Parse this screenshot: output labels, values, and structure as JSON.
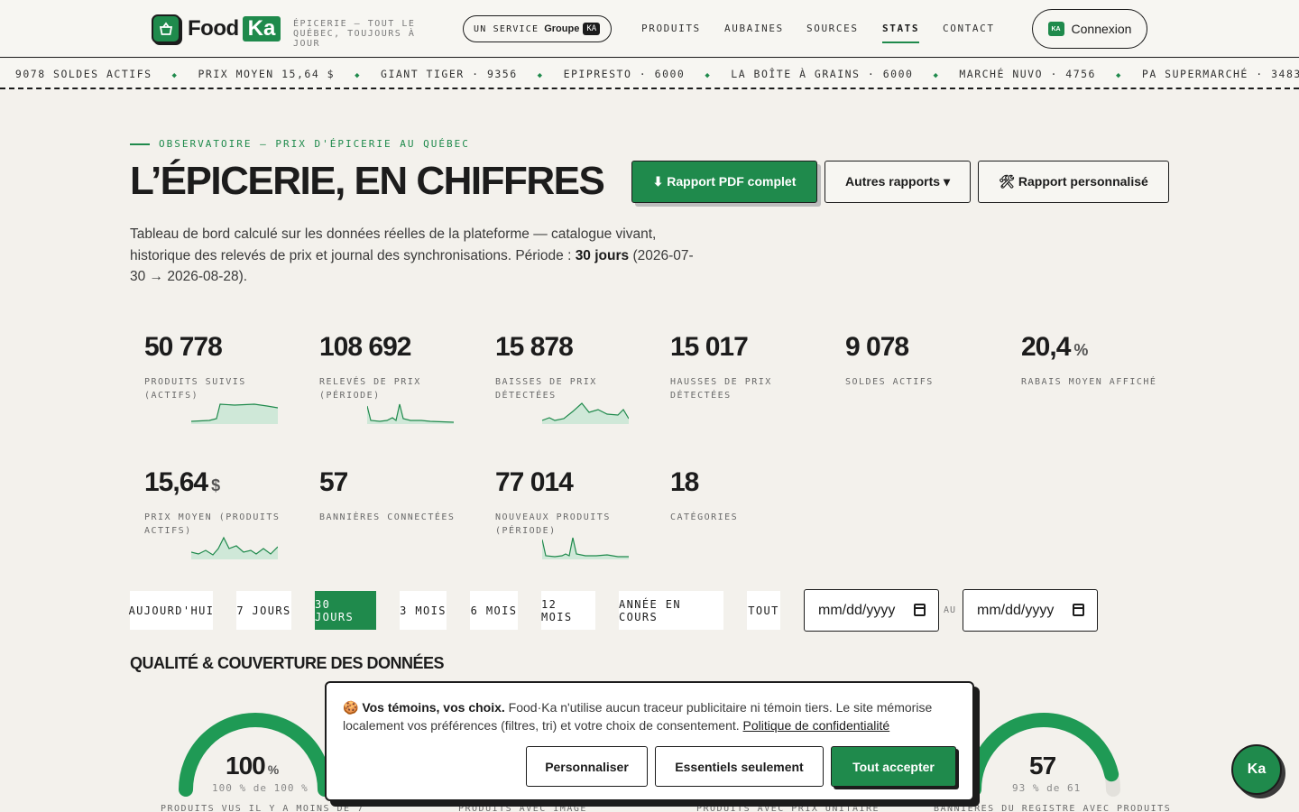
{
  "header": {
    "logo_food": "Food",
    "logo_ka": "Ka",
    "tagline": "ÉPICERIE — TOUT LE QUÉBEC, TOUJOURS À JOUR",
    "service_prefix": "UN SERVICE",
    "service_groupe": "Groupe",
    "service_badge": "KA",
    "nav": [
      "PRODUITS",
      "AUBAINES",
      "SOURCES",
      "STATS",
      "CONTACT"
    ],
    "nav_active": "STATS",
    "login_badge": "KA",
    "login_label": "Connexion"
  },
  "ticker": [
    "9078 SOLDES ACTIFS",
    "PRIX MOYEN 15,64 $",
    "GIANT TIGER · 9356",
    "EPIPRESTO · 6000",
    "LA BOÎTE À GRAINS · 6000",
    "MARCHÉ NUVO · 4756",
    "PA SUPERMARCHÉ · 3483"
  ],
  "intro": {
    "eyebrow": "OBSERVATOIRE — PRIX D'ÉPICERIE AU QUÉBEC",
    "title": "L’ÉPICERIE, EN CHIFFRES",
    "desc_before": "Tableau de bord calculé sur les données réelles de la plateforme — catalogue vivant, historique des relevés de prix et journal des synchronisations. Période : ",
    "desc_bold": "30 jours",
    "desc_after": " (2026-07-30 → 2026-08-28).",
    "btn_pdf": "⬇ Rapport PDF complet",
    "btn_autres": "Autres rapports ▾",
    "btn_perso": "🛠 Rapport personnalisé"
  },
  "stats": [
    {
      "value": "50 778",
      "unit": "",
      "label": "PRODUITS SUIVIS (ACTIFS)"
    },
    {
      "value": "108 692",
      "unit": "",
      "label": "RELEVÉS DE PRIX (PÉRIODE)"
    },
    {
      "value": "15 878",
      "unit": "",
      "label": "BAISSES DE PRIX DÉTECTÉES"
    },
    {
      "value": "15 017",
      "unit": "",
      "label": "HAUSSES DE PRIX DÉTECTÉES"
    },
    {
      "value": "9 078",
      "unit": "",
      "label": "SOLDES ACTIFS"
    },
    {
      "value": "20,4",
      "unit": "%",
      "label": "RABAIS MOYEN AFFICHÉ"
    },
    {
      "value": "15,64",
      "unit": "$",
      "label": "PRIX MOYEN (PRODUITS ACTIFS)"
    },
    {
      "value": "57",
      "unit": "",
      "label": "BANNIÈRES CONNECTÉES"
    },
    {
      "value": "77 014",
      "unit": "",
      "label": "NOUVEAUX PRODUITS (PÉRIODE)"
    },
    {
      "value": "18",
      "unit": "",
      "label": "CATÉGORIES"
    }
  ],
  "periods": [
    "AUJOURD'HUI",
    "7 JOURS",
    "30 JOURS",
    "3 MOIS",
    "6 MOIS",
    "12 MOIS",
    "ANNÉE EN COURS",
    "TOUT"
  ],
  "period_active": "30 JOURS",
  "date_from_placeholder": "mm/dd/yyyy",
  "date_to_placeholder": "mm/dd/yyyy",
  "date_sep": "AU",
  "quality": {
    "title": "QUALITÉ & COUVERTURE DES DONNÉES",
    "gauges": [
      {
        "value": "100",
        "unit": "%",
        "sub": "100 % de 100 %",
        "label": "PRODUITS VUS IL Y A MOINS DE 7",
        "fraction": 1.0
      },
      {
        "label": "PRODUITS AVEC IMAGE"
      },
      {
        "label": "PRODUITS AVEC PRIX UNITAIRE"
      },
      {
        "value": "57",
        "unit": "",
        "sub": "93 % de 61",
        "label": "BANNIÈRES DU REGISTRE AVEC PRODUITS",
        "fraction": 0.93
      }
    ]
  },
  "cookie": {
    "icon": "🍪",
    "title": "Vos témoins, vos choix.",
    "text": " Food·Ka n'utilise aucun traceur publicitaire ni témoin tiers. Le site mémorise localement vos préférences (filtres, tri) et votre choix de consentement. ",
    "link": "Politique de confidentialité",
    "btn_custom": "Personnaliser",
    "btn_essential": "Essentiels seulement",
    "btn_accept": "Tout accepter"
  },
  "fab_label": "Ka",
  "colors": {
    "accent": "#1f8a4c",
    "ink": "#1c1c1c",
    "background": "#f3f1ec"
  }
}
